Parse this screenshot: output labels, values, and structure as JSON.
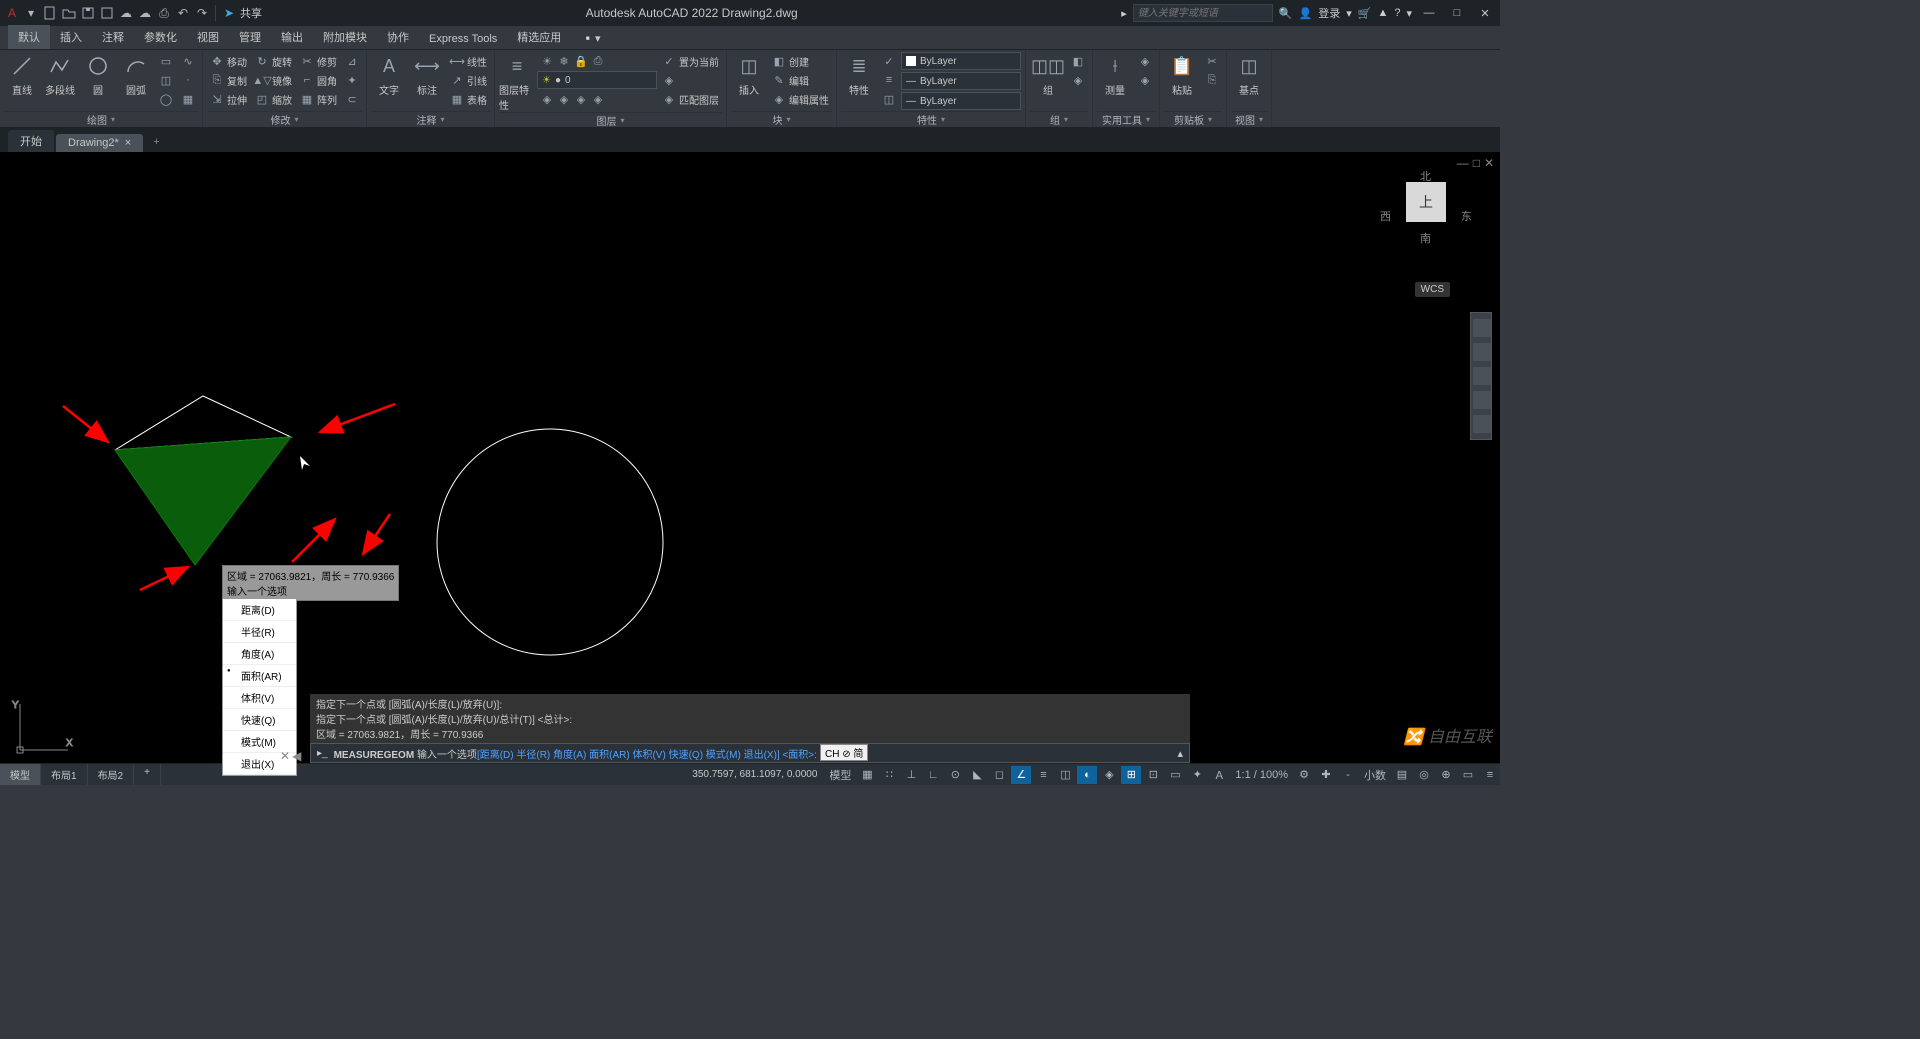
{
  "app": {
    "title": "Autodesk AutoCAD 2022   Drawing2.dwg",
    "share": "共享",
    "search_placeholder": "键入关键字或短语",
    "login": "登录"
  },
  "ribbon_tabs": [
    "默认",
    "插入",
    "注释",
    "参数化",
    "视图",
    "管理",
    "输出",
    "附加模块",
    "协作",
    "Express Tools",
    "精选应用"
  ],
  "active_ribbon_tab": 0,
  "panels": {
    "draw": {
      "label": "绘图",
      "items": [
        "直线",
        "多段线",
        "圆",
        "圆弧"
      ]
    },
    "modify": {
      "label": "修改",
      "rows": [
        [
          "移动",
          "旋转",
          "修剪"
        ],
        [
          "复制",
          "镜像",
          "圆角"
        ],
        [
          "拉伸",
          "缩放",
          "阵列"
        ]
      ]
    },
    "annotation": {
      "label": "注释",
      "items": [
        "文字",
        "标注"
      ],
      "rows": [
        "线性",
        "引线",
        "表格"
      ]
    },
    "layers": {
      "label": "图层",
      "main": "图层特性",
      "rows": [
        "置为当前",
        "",
        "匹配图层"
      ]
    },
    "block": {
      "label": "块",
      "main": "插入",
      "rows": [
        "创建",
        "编辑",
        "编辑属性"
      ]
    },
    "properties": {
      "label": "特性",
      "main": "特性",
      "bylayer": "ByLayer"
    },
    "groups": {
      "label": "组",
      "main": "组"
    },
    "utilities": {
      "label": "实用工具",
      "main": "测量"
    },
    "clipboard": {
      "label": "剪贴板",
      "main": "粘贴"
    },
    "view": {
      "label": "视图",
      "main": "基点"
    }
  },
  "doc_tabs": {
    "start": "开始",
    "active": "Drawing2*"
  },
  "viewcube": {
    "top": "上",
    "n": "北",
    "s": "南",
    "e": "东",
    "w": "西",
    "wcs": "WCS"
  },
  "tooltip": {
    "line1": "区域 = 27063.9821，周长 = 770.9366",
    "line2": "输入一个选项"
  },
  "ctx_menu": [
    "距离(D)",
    "半径(R)",
    "角度(A)",
    "面积(AR)",
    "体积(V)",
    "快速(Q)",
    "模式(M)",
    "退出(X)"
  ],
  "ctx_sel": 3,
  "cmd_history": [
    "指定下一个点或 [圆弧(A)/长度(L)/放弃(U)]:",
    "指定下一个点或 [圆弧(A)/长度(L)/放弃(U)/总计(T)] <总计>:",
    "区域 = 27063.9821，周长 = 770.9366"
  ],
  "cmd_current": {
    "cmd": "MEASUREGEOM",
    "prompt": "输入一个选项",
    "opts": "[距离(D) 半径(R) 角度(A) 面积(AR) 体积(V) 快速(Q) 模式(M) 退出(X)] <面积>:"
  },
  "layout_tabs": [
    "模型",
    "布局1",
    "布局2"
  ],
  "active_layout": 0,
  "coords": "350.7597, 681.1097, 0.0000",
  "status_mode": "模型",
  "ime": "CH ⊘ 简",
  "scale": "1:1 / 100%",
  "minus": "-",
  "dec": "小数",
  "watermark": "自由互联",
  "chart_data": {
    "type": "diagram",
    "triangle_area": 27063.9821,
    "triangle_perimeter": 770.9366,
    "circle_center": [
      550,
      390
    ],
    "circle_radius": 113
  }
}
